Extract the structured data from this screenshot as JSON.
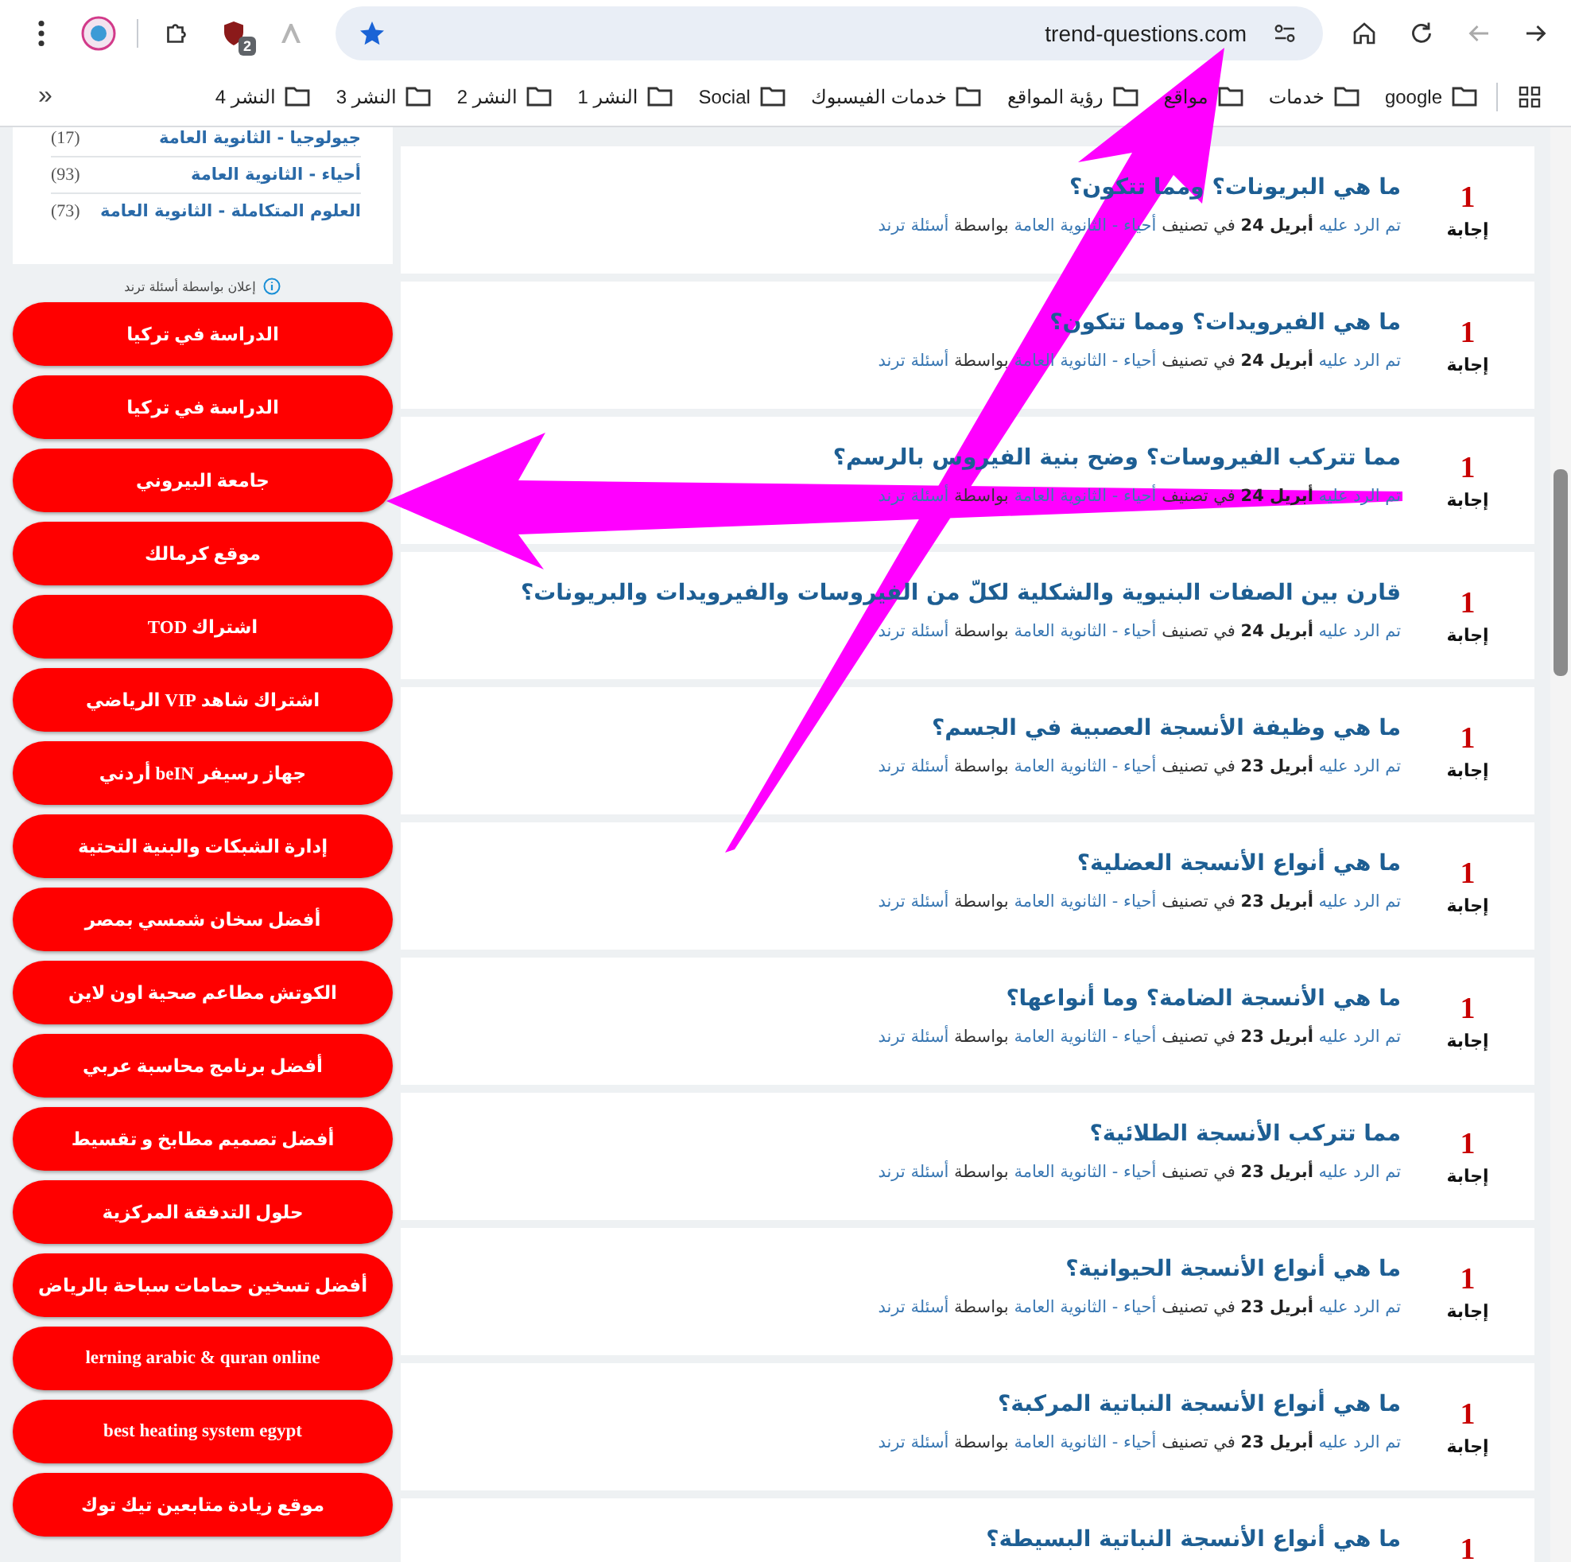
{
  "browser": {
    "address": "trend-questions.com",
    "extension_badge": "2",
    "bookmarks_more": "»",
    "bookmarks": [
      {
        "label": "google"
      },
      {
        "label": "خدمات"
      },
      {
        "label": "مواقع"
      },
      {
        "label": "رؤية المواقع"
      },
      {
        "label": "خدمات الفيسبوك"
      },
      {
        "label": "Social"
      },
      {
        "label": "النشر 1"
      },
      {
        "label": "النشر 2"
      },
      {
        "label": "النشر 3"
      },
      {
        "label": "النشر 4"
      }
    ]
  },
  "sidebar": {
    "categories": [
      {
        "label": "جيولوجيا - الثانوية العامة",
        "count": "(17)"
      },
      {
        "label": "أحياء - الثانوية العامة",
        "count": "(93)"
      },
      {
        "label": "العلوم المتكاملة - الثانوية العامة",
        "count": "(73)"
      }
    ],
    "ad_label": "إعلان بواسطة أسئلة ترند",
    "links": [
      "الدراسة في تركيا",
      "الدراسة في تركيا",
      "جامعة البيروني",
      "موقع كرمالك",
      "اشتراك TOD",
      "اشتراك شاهد VIP الرياضي",
      "جهاز رسيفر beIN أردني",
      "إدارة الشبكات والبنية التحتية",
      "أفضل سخان شمسي بمصر",
      "الكوتش مطاعم صحية اون لاين",
      "أفضل برنامج محاسبة عربي",
      "أفضل تصميم مطابخ و تقسيط",
      "حلول التدفقة المركزية",
      "أفضل تسخين حمامات سباحة بالرياض",
      "lerning arabic & quran online",
      "best heating system egypt",
      "موقع زيادة متابعين تيك توك"
    ]
  },
  "questions": [
    {
      "answers": "1",
      "answers_label": "إجابة",
      "title": "ما هي البريونات؟ ومما تتكون؟",
      "meta": {
        "answered": "تم الرد عليه",
        "date": "أبريل 24",
        "in": "في تصنيف",
        "category": "أحياء - الثانوية العامة",
        "by": "بواسطة",
        "author": "أسئلة ترند"
      }
    },
    {
      "answers": "1",
      "answers_label": "إجابة",
      "title": "ما هي الفيرويدات؟ ومما تتكون؟",
      "meta": {
        "answered": "تم الرد عليه",
        "date": "أبريل 24",
        "in": "في تصنيف",
        "category": "أحياء - الثانوية العامة",
        "by": "بواسطة",
        "author": "أسئلة ترند"
      }
    },
    {
      "answers": "1",
      "answers_label": "إجابة",
      "title": "مما تتركب الفيروسات؟ وضح بنية الفيروس بالرسم؟",
      "meta": {
        "answered": "تم الرد عليه",
        "date": "أبريل 24",
        "in": "في تصنيف",
        "category": "أحياء - الثانوية العامة",
        "by": "بواسطة",
        "author": "أسئلة ترند"
      }
    },
    {
      "answers": "1",
      "answers_label": "إجابة",
      "title": "قارن بين الصفات البنيوية والشكلية لكلّ من الفيروسات والفيرويدات والبريونات؟",
      "meta": {
        "answered": "تم الرد عليه",
        "date": "أبريل 24",
        "in": "في تصنيف",
        "category": "أحياء - الثانوية العامة",
        "by": "بواسطة",
        "author": "أسئلة ترند"
      }
    },
    {
      "answers": "1",
      "answers_label": "إجابة",
      "title": "ما هي وظيفة الأنسجة العصبية في الجسم؟",
      "meta": {
        "answered": "تم الرد عليه",
        "date": "أبريل 23",
        "in": "في تصنيف",
        "category": "أحياء - الثانوية العامة",
        "by": "بواسطة",
        "author": "أسئلة ترند"
      }
    },
    {
      "answers": "1",
      "answers_label": "إجابة",
      "title": "ما هي أنواع الأنسجة العضلية؟",
      "meta": {
        "answered": "تم الرد عليه",
        "date": "أبريل 23",
        "in": "في تصنيف",
        "category": "أحياء - الثانوية العامة",
        "by": "بواسطة",
        "author": "أسئلة ترند"
      }
    },
    {
      "answers": "1",
      "answers_label": "إجابة",
      "title": "ما هي الأنسجة الضامة؟ وما أنواعها؟",
      "meta": {
        "answered": "تم الرد عليه",
        "date": "أبريل 23",
        "in": "في تصنيف",
        "category": "أحياء - الثانوية العامة",
        "by": "بواسطة",
        "author": "أسئلة ترند"
      }
    },
    {
      "answers": "1",
      "answers_label": "إجابة",
      "title": "مما تتركب الأنسجة الطلائية؟",
      "meta": {
        "answered": "تم الرد عليه",
        "date": "أبريل 23",
        "in": "في تصنيف",
        "category": "أحياء - الثانوية العامة",
        "by": "بواسطة",
        "author": "أسئلة ترند"
      }
    },
    {
      "answers": "1",
      "answers_label": "إجابة",
      "title": "ما هي أنواع الأنسجة الحيوانية؟",
      "meta": {
        "answered": "تم الرد عليه",
        "date": "أبريل 23",
        "in": "في تصنيف",
        "category": "أحياء - الثانوية العامة",
        "by": "بواسطة",
        "author": "أسئلة ترند"
      }
    },
    {
      "answers": "1",
      "answers_label": "إجابة",
      "title": "ما هي أنواع الأنسجة النباتية المركبة؟",
      "meta": {
        "answered": "تم الرد عليه",
        "date": "أبريل 23",
        "in": "في تصنيف",
        "category": "أحياء - الثانوية العامة",
        "by": "بواسطة",
        "author": "أسئلة ترند"
      }
    },
    {
      "answers": "1",
      "title": "ما هي أنواع الأنسجة النباتية البسيطة؟"
    }
  ]
}
